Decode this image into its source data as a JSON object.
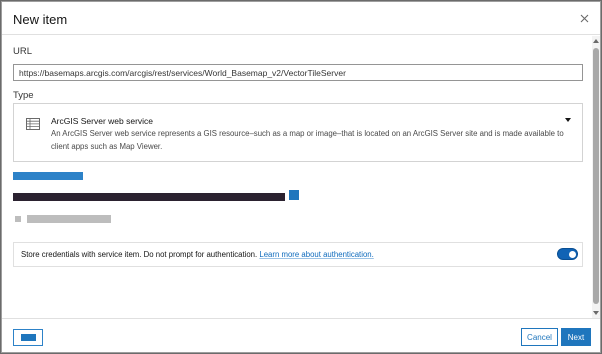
{
  "dialog": {
    "title": "New item",
    "close_icon": "close-icon"
  },
  "url": {
    "label": "URL",
    "value": "https://basemaps.arcgis.com/arcgis/rest/services/World_Basemap_v2/VectorTileServer",
    "placeholder": ""
  },
  "type": {
    "label": "Type",
    "icon": "table-icon",
    "selected_name": "ArcGIS Server web service",
    "selected_description": "An ArcGIS Server web service represents a GIS resource–such as a map or image–that is located on an ArcGIS Server site and is made available to client apps such as Map Viewer.",
    "caret_icon": "caret-down-icon"
  },
  "credentials": {
    "text": "Store credentials with service item. Do not prompt for authentication.",
    "link_label": "Learn more about authentication.",
    "toggle_on": true
  },
  "footer": {
    "cancel_label": "Cancel",
    "next_label": "Next"
  },
  "colors": {
    "accent": "#1f76bd",
    "placeholder_blue": "#2d82c8",
    "placeholder_dark": "#2b2230",
    "placeholder_gray": "#bdbdbd"
  }
}
